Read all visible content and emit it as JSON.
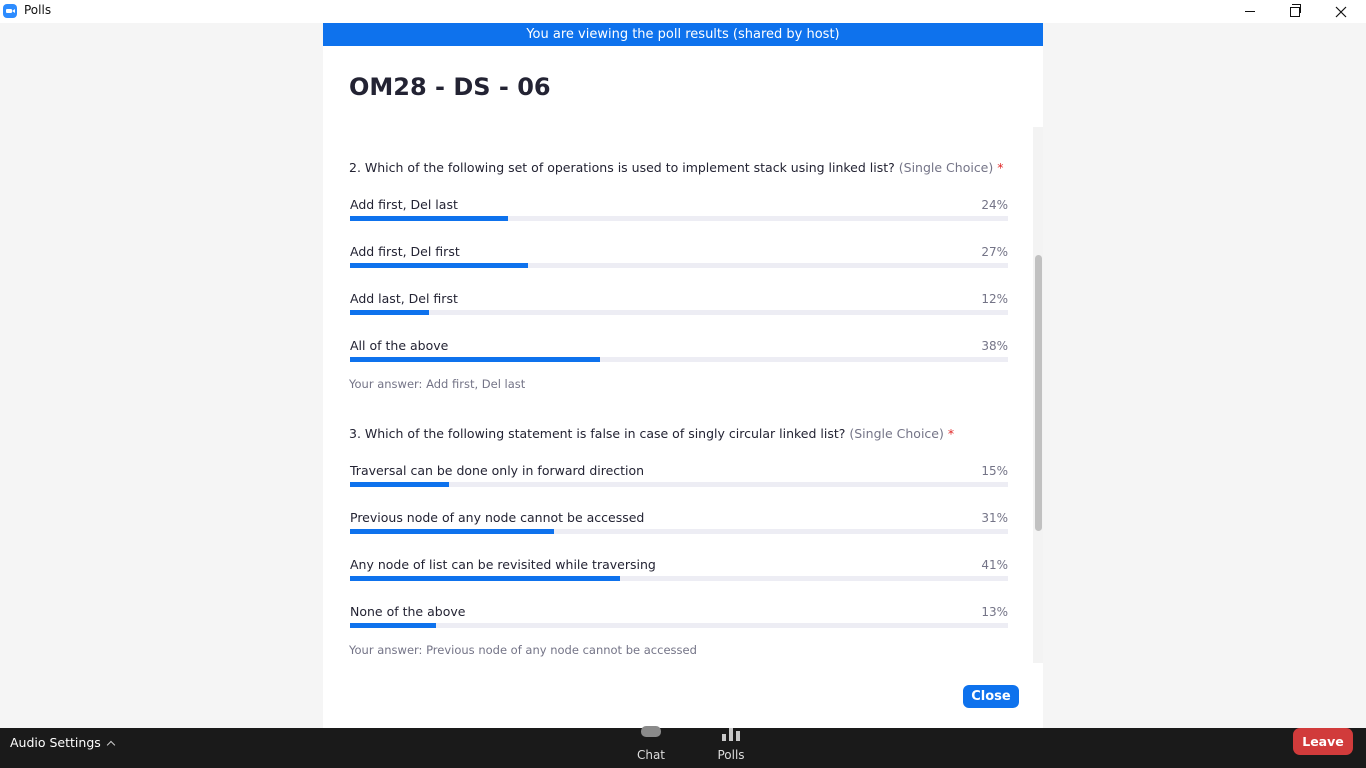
{
  "window": {
    "title": "Polls"
  },
  "banner": "You are viewing the poll results (shared by host)",
  "poll": {
    "title": "OM28 - DS - 06",
    "questions": [
      {
        "text": "2. Which of the following set of operations is used to implement stack using linked list?",
        "type": "(Single Choice)",
        "required": "*",
        "options": [
          {
            "label": "Add first, Del last",
            "percent": "24%",
            "value": 24
          },
          {
            "label": "Add first, Del first",
            "percent": "27%",
            "value": 27
          },
          {
            "label": "Add last, Del first",
            "percent": "12%",
            "value": 12
          },
          {
            "label": "All of the above",
            "percent": "38%",
            "value": 38
          }
        ],
        "your_answer": "Your answer: Add first, Del last"
      },
      {
        "text": "3. Which of the following statement is false in case of singly circular linked list?",
        "type": "(Single Choice)",
        "required": "*",
        "options": [
          {
            "label": "Traversal can be done only in forward direction",
            "percent": "15%",
            "value": 15
          },
          {
            "label": "Previous node of any node cannot be accessed",
            "percent": "31%",
            "value": 31
          },
          {
            "label": "Any node of list can be revisited while traversing",
            "percent": "41%",
            "value": 41
          },
          {
            "label": "None of the above",
            "percent": "13%",
            "value": 13
          }
        ],
        "your_answer": "Your answer: Previous node of any node cannot be accessed"
      }
    ],
    "close_label": "Close"
  },
  "bottombar": {
    "audio_settings": "Audio Settings",
    "chat": "Chat",
    "polls": "Polls",
    "leave": "Leave"
  },
  "colors": {
    "accent": "#0e72ed",
    "leave": "#d13b3b",
    "bar_track": "#ededf4"
  },
  "icons": [
    "zoom-app-icon",
    "minimize-icon",
    "restore-icon",
    "close-icon",
    "chevron-up-icon",
    "chat-icon",
    "polls-icon"
  ]
}
